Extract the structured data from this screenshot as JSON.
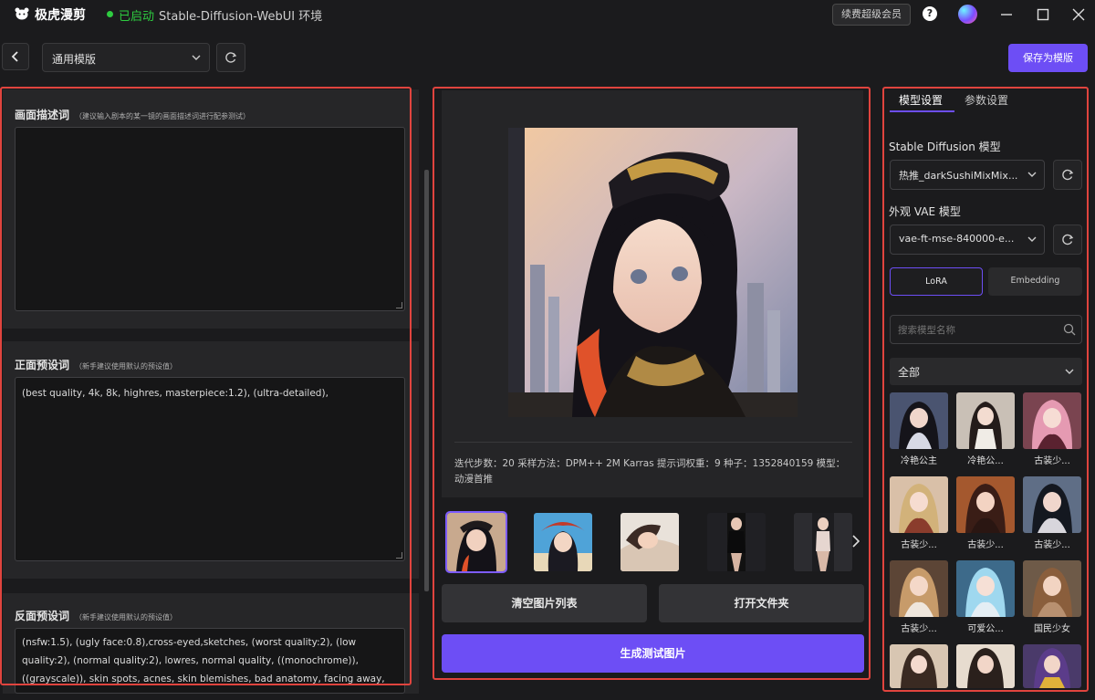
{
  "app": {
    "name": "极虎漫剪",
    "status": "已启动",
    "environment": "Stable-Diffusion-WebUI 环境",
    "renew_label": "续费超级会员",
    "help_glyph": "?"
  },
  "toolbar": {
    "template_value": "通用模版",
    "save_template_label": "保存为模版"
  },
  "scene": {
    "title": "画面描述词",
    "hint": "（建议输入剧本的某一镜的画面描述词进行配参测试）",
    "value": ""
  },
  "positive": {
    "title": "正面预设词",
    "hint": "（新手建议使用默认的预设值）",
    "value": "(best quality, 4k, 8k, highres, masterpiece:1.2), (ultra-detailed),"
  },
  "negative": {
    "title": "反面预设词",
    "hint": "（新手建议使用默认的预设值）",
    "value": "(nsfw:1.5), (ugly face:0.8),cross-eyed,sketches, (worst quality:2), (low quality:2), (normal quality:2), lowres, normal quality, ((monochrome)), ((grayscale)), skin spots, acnes, skin blemishes, bad anatomy, facing away, tilted head, Multiple people, lowres,"
  },
  "preview": {
    "meta_line1": "迭代步数：20   采样方法：DPM++ 2M Karras   提示词权重：9   种子：1352840159   模型：",
    "meta_line2": "动漫首推",
    "clear_label": "清空图片列表",
    "open_folder_label": "打开文件夹",
    "generate_label": "生成测试图片"
  },
  "settings": {
    "tabs": [
      "模型设置",
      "参数设置"
    ],
    "sd_label": "Stable Diffusion 模型",
    "sd_value": "热推_darkSushiMixMix...",
    "vae_label": "外观 VAE 模型",
    "vae_value": "vae-ft-mse-840000-e...",
    "seg": [
      "LoRA",
      "Embedding"
    ],
    "search_placeholder": "搜索模型名称",
    "filter_value": "全部",
    "models": [
      "冷艳公主",
      "冷艳公...",
      "古装少...",
      "古装少...",
      "古装少...",
      "古装少...",
      "古装少...",
      "可爱公...",
      "国民少女",
      "",
      "",
      ""
    ]
  },
  "colors": {
    "accent": "#6d4ef5",
    "status_green": "#2ecc40",
    "outline_red": "#e0443e"
  }
}
